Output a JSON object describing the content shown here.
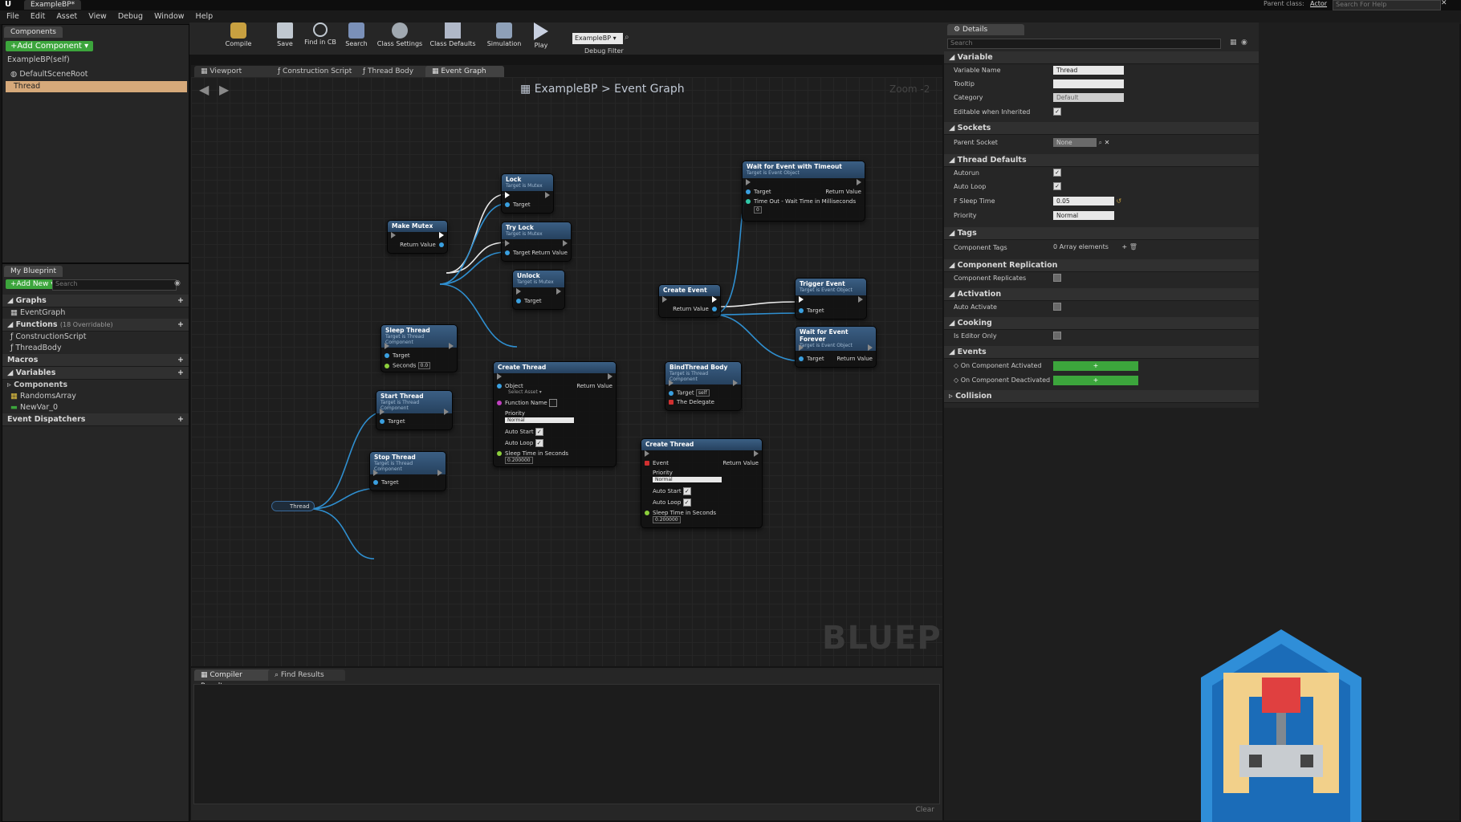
{
  "window": {
    "tab": "ExampleBP*",
    "parent_class_label": "Parent class:",
    "parent_class": "Actor",
    "help_search_placeholder": "Search For Help"
  },
  "menu": [
    "File",
    "Edit",
    "Asset",
    "View",
    "Debug",
    "Window",
    "Help"
  ],
  "components_panel": {
    "tab": "Components",
    "add_button": "+Add Component ▾",
    "items": [
      "ExampleBP(self)",
      "DefaultSceneRoot",
      "Thread"
    ]
  },
  "my_blueprint": {
    "tab": "My Blueprint",
    "add_new": "+Add New ▾",
    "search_placeholder": "Search",
    "graphs_label": "Graphs",
    "graphs": [
      "EventGraph"
    ],
    "functions_label": "Functions",
    "functions_overridable": "(18 Overridable)",
    "functions": [
      "ConstructionScript",
      "ThreadBody"
    ],
    "macros_label": "Macros",
    "variables_label": "Variables",
    "components_label": "Components",
    "variables": [
      "RandomsArray",
      "NewVar_0"
    ],
    "event_dispatchers_label": "Event Dispatchers"
  },
  "toolbar": {
    "buttons": [
      "Compile",
      "Save",
      "Find in CB",
      "Search",
      "Class Settings",
      "Class Defaults",
      "Simulation",
      "Play"
    ],
    "debug_object": "ExampleBP ▾",
    "debug_filter": "Debug Filter"
  },
  "graph_tabs": [
    "Viewport",
    "Construction Script",
    "Thread Body",
    "Event Graph"
  ],
  "graph": {
    "breadcrumb_bp": "ExampleBP",
    "breadcrumb_sep": ">",
    "breadcrumb_graph": "Event Graph",
    "zoom": "Zoom -2",
    "watermark": "BLUEPRINT"
  },
  "nodes": {
    "lock": {
      "title": "Lock",
      "sub": "Target is Mutex",
      "target": "Target"
    },
    "trylock": {
      "title": "Try Lock",
      "sub": "Target is Mutex",
      "target": "Target",
      "ret": "Return Value"
    },
    "unlock": {
      "title": "Unlock",
      "sub": "Target is Mutex",
      "target": "Target"
    },
    "makemutex": {
      "title": "Make Mutex",
      "ret": "Return Value"
    },
    "sleep": {
      "title": "Sleep Thread",
      "sub": "Target is Thread Component",
      "target": "Target",
      "seconds": "Seconds",
      "seconds_val": "0.0"
    },
    "start": {
      "title": "Start Thread",
      "sub": "Target is Thread Component",
      "target": "Target"
    },
    "stop": {
      "title": "Stop Thread",
      "sub": "Target is Thread Component",
      "target": "Target"
    },
    "thread_var": {
      "title": "Thread"
    },
    "create1": {
      "title": "Create Thread",
      "object": "Object",
      "object_val": "Select Asset ▾",
      "ret": "Return Value",
      "fn": "Function Name",
      "priority": "Priority",
      "priority_val": "Normal",
      "autostart": "Auto Start",
      "autoloop": "Auto Loop",
      "sleep": "Sleep Time in Seconds",
      "sleep_val": "0.200000"
    },
    "bind": {
      "title": "BindThread Body",
      "sub": "Target is Thread Component",
      "target": "Target",
      "self": "self",
      "delegate": "The Delegate"
    },
    "create2": {
      "title": "Create Thread",
      "event": "Event",
      "ret": "Return Value",
      "priority": "Priority",
      "priority_val": "Normal",
      "autostart": "Auto Start",
      "autoloop": "Auto Loop",
      "sleep": "Sleep Time in Seconds",
      "sleep_val": "0.200000"
    },
    "waittimeout": {
      "title": "Wait for Event with Timeout",
      "sub": "Target is Event Object",
      "target": "Target",
      "ret": "Return Value",
      "timeout": "Time Out - Wait Time in Milliseconds",
      "timeout_val": "0"
    },
    "createevent": {
      "title": "Create Event",
      "ret": "Return Value"
    },
    "trigger": {
      "title": "Trigger Event",
      "sub": "Target is Event Object",
      "target": "Target"
    },
    "waitforever": {
      "title": "Wait for Event Forever",
      "sub": "Target is Event Object",
      "target": "Target",
      "ret": "Return Value"
    }
  },
  "bottom": {
    "tabs": [
      "Compiler Results",
      "Find Results"
    ],
    "clear": "Clear"
  },
  "details": {
    "tab": "Details",
    "search_placeholder": "Search",
    "variable": {
      "hdr": "Variable",
      "name_lbl": "Variable Name",
      "name_val": "Thread",
      "tooltip_lbl": "Tooltip",
      "category_lbl": "Category",
      "category_val": "Default",
      "editable_lbl": "Editable when Inherited"
    },
    "sockets": {
      "hdr": "Sockets",
      "parent_lbl": "Parent Socket",
      "parent_val": "None"
    },
    "thread_defaults": {
      "hdr": "Thread Defaults",
      "autorun": "Autorun",
      "autoloop": "Auto Loop",
      "sleep_lbl": "F Sleep Time",
      "sleep_val": "0.05",
      "priority_lbl": "Priority",
      "priority_val": "Normal"
    },
    "tags": {
      "hdr": "Tags",
      "comp_tags": "Component Tags",
      "count": "0 Array elements"
    },
    "replication": {
      "hdr": "Component Replication",
      "replicates": "Component Replicates"
    },
    "activation": {
      "hdr": "Activation",
      "auto_activate": "Auto Activate"
    },
    "cooking": {
      "hdr": "Cooking",
      "editor_only": "Is Editor Only"
    },
    "events": {
      "hdr": "Events",
      "activated": "On Component Activated",
      "deactivated": "On Component Deactivated"
    },
    "collision": {
      "hdr": "Collision"
    }
  },
  "colors": {
    "accent_green": "#3ca53c",
    "selection": "#d6a97a",
    "node_header": "#26415e",
    "wire": "#2f8fd0"
  }
}
